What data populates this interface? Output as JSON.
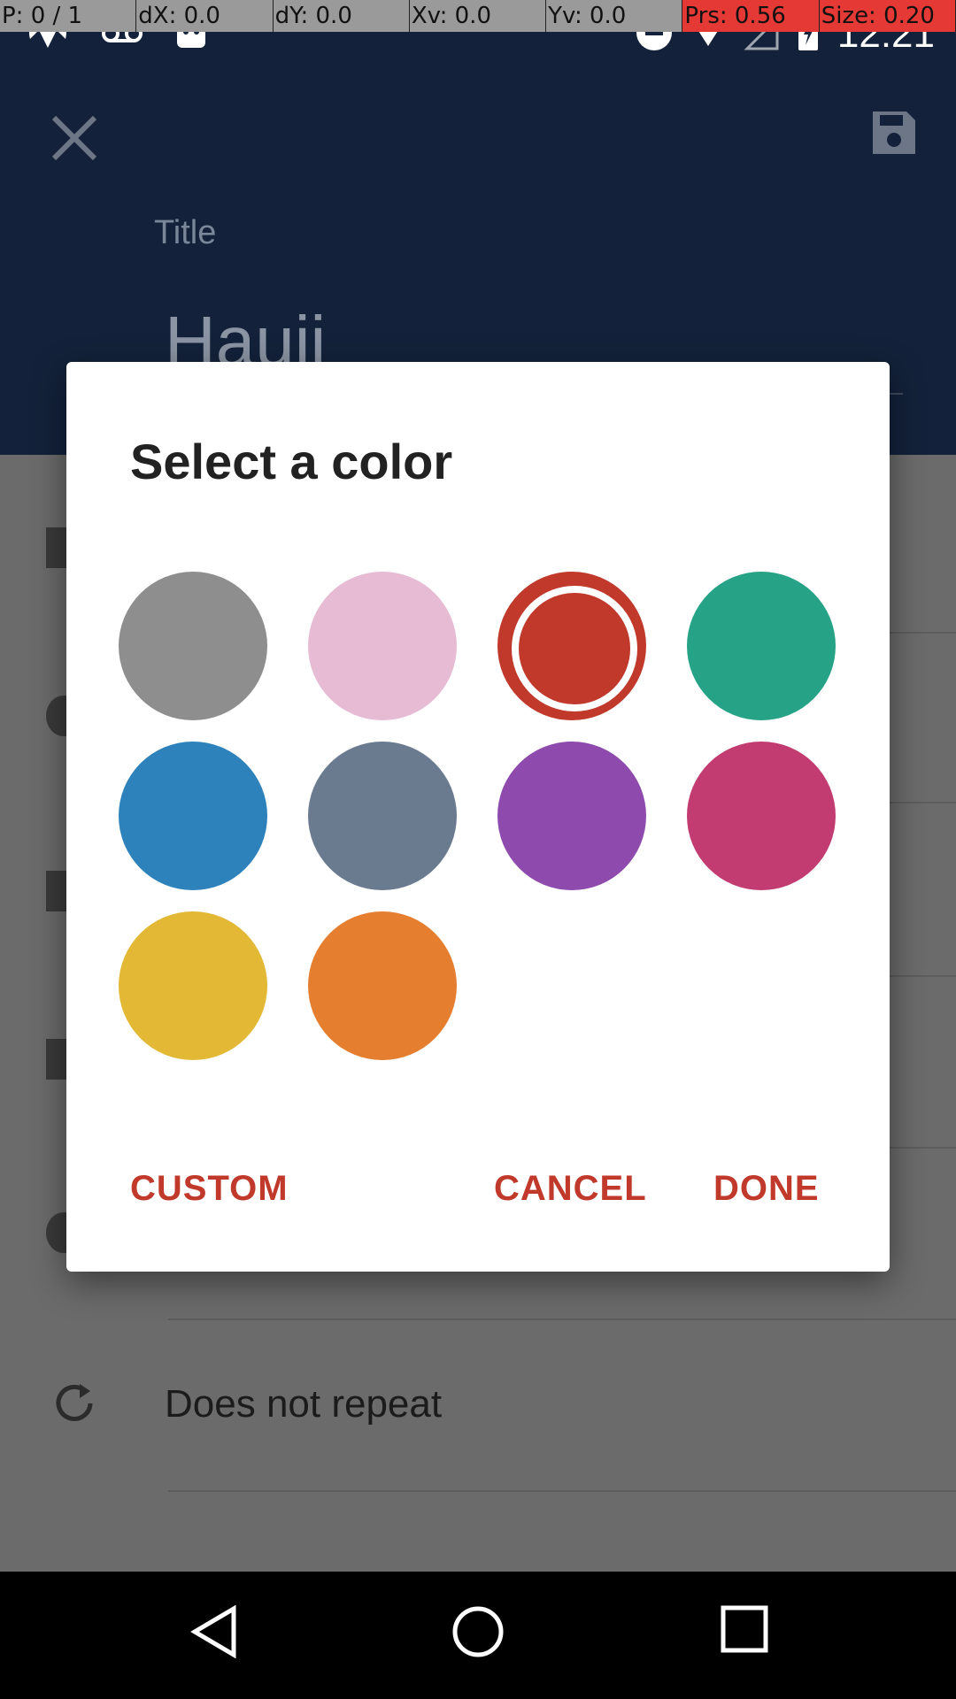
{
  "debug_overlay": [
    "P: 0 / 1",
    "dX: 0.0",
    "dY: 0.0",
    "Xv: 0.0",
    "Yv: 0.0",
    "Prs: 0.56",
    "Size: 0.20"
  ],
  "status_bar": {
    "time": "12:21"
  },
  "header": {
    "title_label": "Title",
    "title_value": "Hauii"
  },
  "repeat": {
    "label": "Does not repeat"
  },
  "dialog": {
    "title": "Select a color",
    "colors": [
      "#8e8e8e",
      "#e6bbd3",
      "#c0392b",
      "#26a386",
      "#2e82bb",
      "#6a7a8f",
      "#8e4aad",
      "#c23b71",
      "#e2b834",
      "#e67e30"
    ],
    "selected_index": 2,
    "buttons": {
      "custom": "CUSTOM",
      "cancel": "CANCEL",
      "done": "DONE"
    },
    "accent": "#c0392b"
  }
}
